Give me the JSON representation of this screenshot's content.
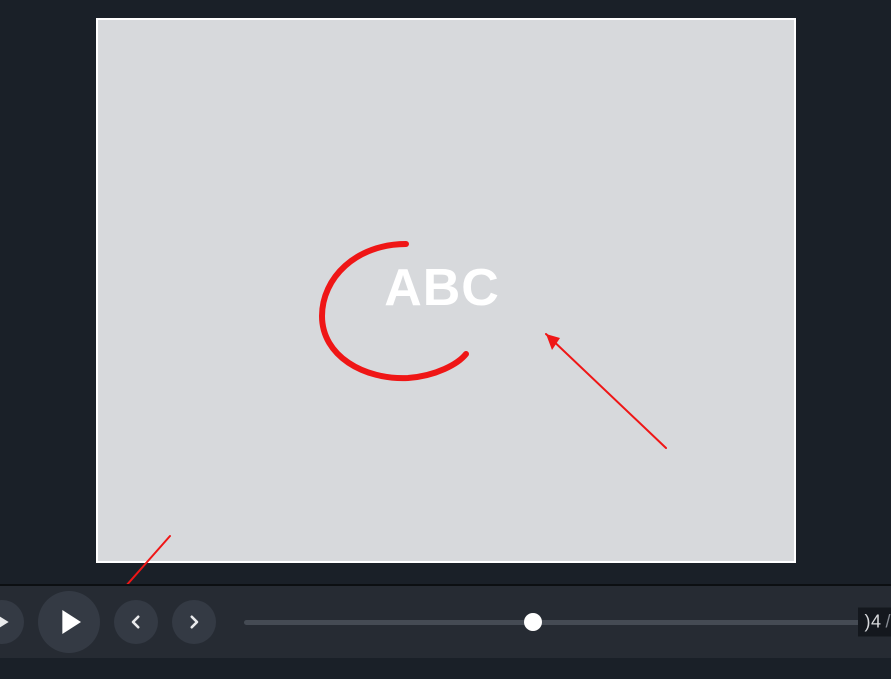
{
  "slide": {
    "center_text": "ABC"
  },
  "toolbar": {
    "slider_percent": 46,
    "counter_value": ")4",
    "counter_separator": "/"
  },
  "colors": {
    "annotation_red": "#ef1616"
  }
}
